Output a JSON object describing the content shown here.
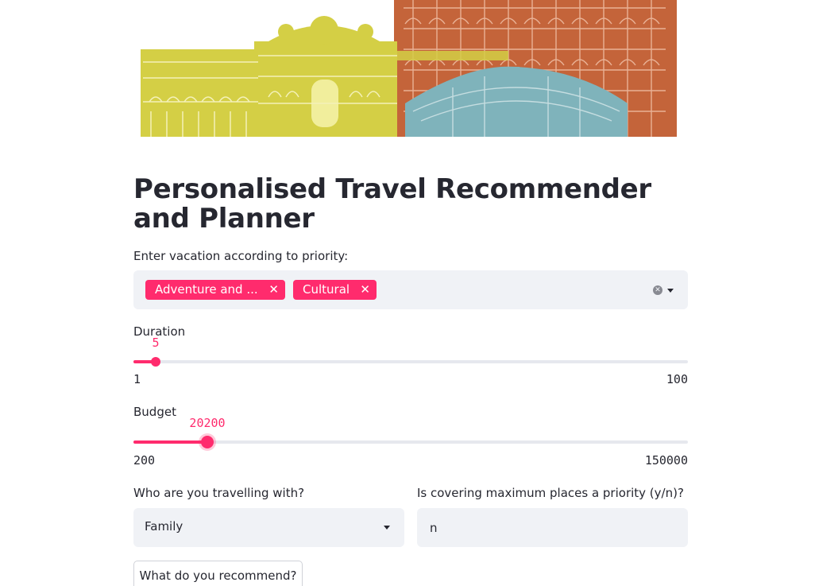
{
  "header": {
    "title": "Personalised Travel Recommender and Planner"
  },
  "vacation": {
    "label": "Enter vacation according to priority:",
    "tags": [
      "Adventure and ...",
      "Cultural"
    ]
  },
  "duration": {
    "label": "Duration",
    "value": "5",
    "min": "1",
    "max": "100"
  },
  "budget": {
    "label": "Budget",
    "value": "20200",
    "min": "200",
    "max": "150000"
  },
  "companions": {
    "label": "Who are you travelling with?",
    "selected": "Family"
  },
  "max_places": {
    "label": "Is covering maximum places a priority (y/n)?",
    "value": "n"
  },
  "recommend_button": {
    "label": "What do you recommend?"
  },
  "colors": {
    "accent": "#ff2b6d",
    "input_bg": "#f0f2f6",
    "banner_yellow": "#d4cf45",
    "banner_orange": "#c4643a",
    "banner_teal": "#7fb3bb"
  }
}
